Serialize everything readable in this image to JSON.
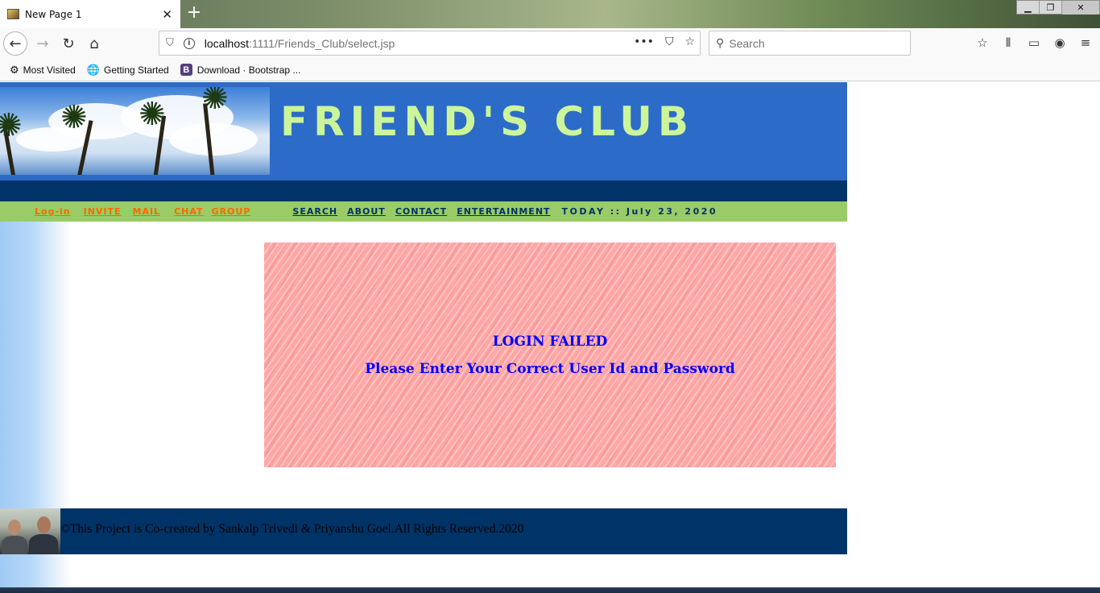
{
  "browser": {
    "tab_title": "New Page 1",
    "url_host": "localhost",
    "url_path": ":1111/Friends_Club/select.jsp",
    "search_placeholder": "Search",
    "bookmarks": [
      {
        "label": "Most Visited",
        "icon": "gear-icon"
      },
      {
        "label": "Getting Started",
        "icon": "globe-icon"
      },
      {
        "label": "Download · Bootstrap ...",
        "icon": "bootstrap-icon"
      }
    ]
  },
  "site": {
    "title": "FRIEND'S CLUB",
    "menu_left": [
      "Log-in",
      "INVITE",
      "MAIL",
      "CHAT",
      "GROUP"
    ],
    "menu_right": [
      "SEARCH",
      "ABOUT",
      "CONTACT",
      "ENTERTAINMENT"
    ],
    "today": "TODAY :: July 23, 2020"
  },
  "message": {
    "title": "LOGIN FAILED",
    "subtitle": "Please Enter Your Correct User Id and Password"
  },
  "footer": {
    "text": "©This Project is Co-created by Sankalp Trivedi & Priyanshu Goel.All Rights Reserved.2020"
  },
  "colors": {
    "header_bg": "#2d6bc8",
    "title": "#ccf59a",
    "menu_bg": "#99cc66",
    "dark_bar": "#003468",
    "message_text": "#0000ff",
    "message_bg": "#ffa6a6"
  }
}
